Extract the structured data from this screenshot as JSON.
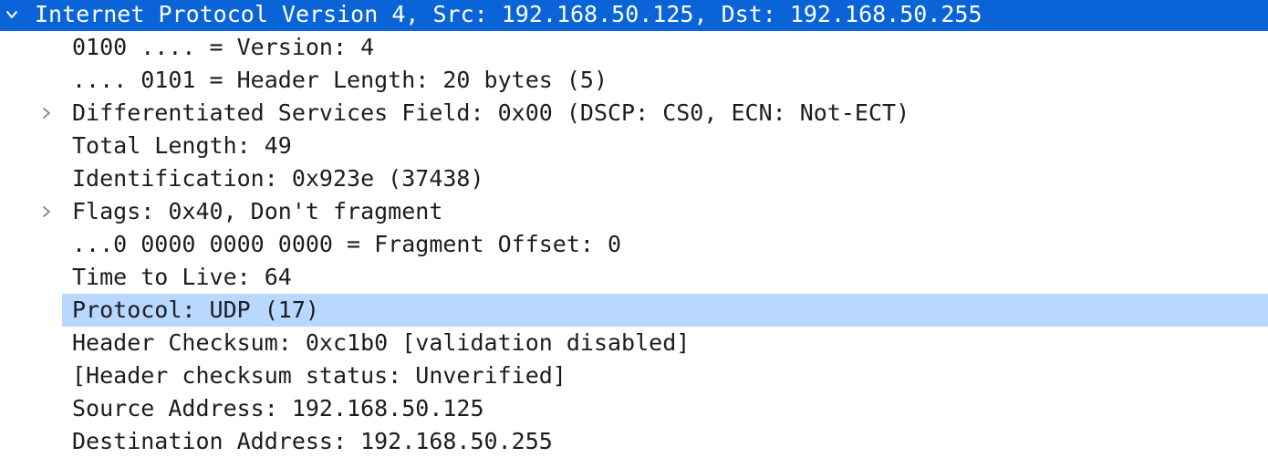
{
  "packet_details": {
    "header": {
      "label": "Internet Protocol Version 4, Src: 192.168.50.125, Dst: 192.168.50.255",
      "expanded": true,
      "icon": "chevron-down-icon"
    },
    "fields": [
      {
        "label": "0100 .... = Version: 4"
      },
      {
        "label": ".... 0101 = Header Length: 20 bytes (5)"
      },
      {
        "label": "Differentiated Services Field: 0x00 (DSCP: CS0, ECN: Not-ECT)",
        "expandable": true,
        "icon": "chevron-right-icon"
      },
      {
        "label": "Total Length: 49"
      },
      {
        "label": "Identification: 0x923e (37438)"
      },
      {
        "label": "Flags: 0x40, Don't fragment",
        "expandable": true,
        "icon": "chevron-right-icon"
      },
      {
        "label": "...0 0000 0000 0000 = Fragment Offset: 0"
      },
      {
        "label": "Time to Live: 64"
      },
      {
        "label": "Protocol: UDP (17)",
        "related": true
      },
      {
        "label": "Header Checksum: 0xc1b0 [validation disabled]"
      },
      {
        "label": "[Header checksum status: Unverified]"
      },
      {
        "label": "Source Address: 192.168.50.125"
      },
      {
        "label": "Destination Address: 192.168.50.255"
      }
    ]
  },
  "colors": {
    "selection": "#0a64d8",
    "related_highlight": "#b8d8ff",
    "text": "#1d1d1f",
    "chevron": "#8a8a8e"
  }
}
